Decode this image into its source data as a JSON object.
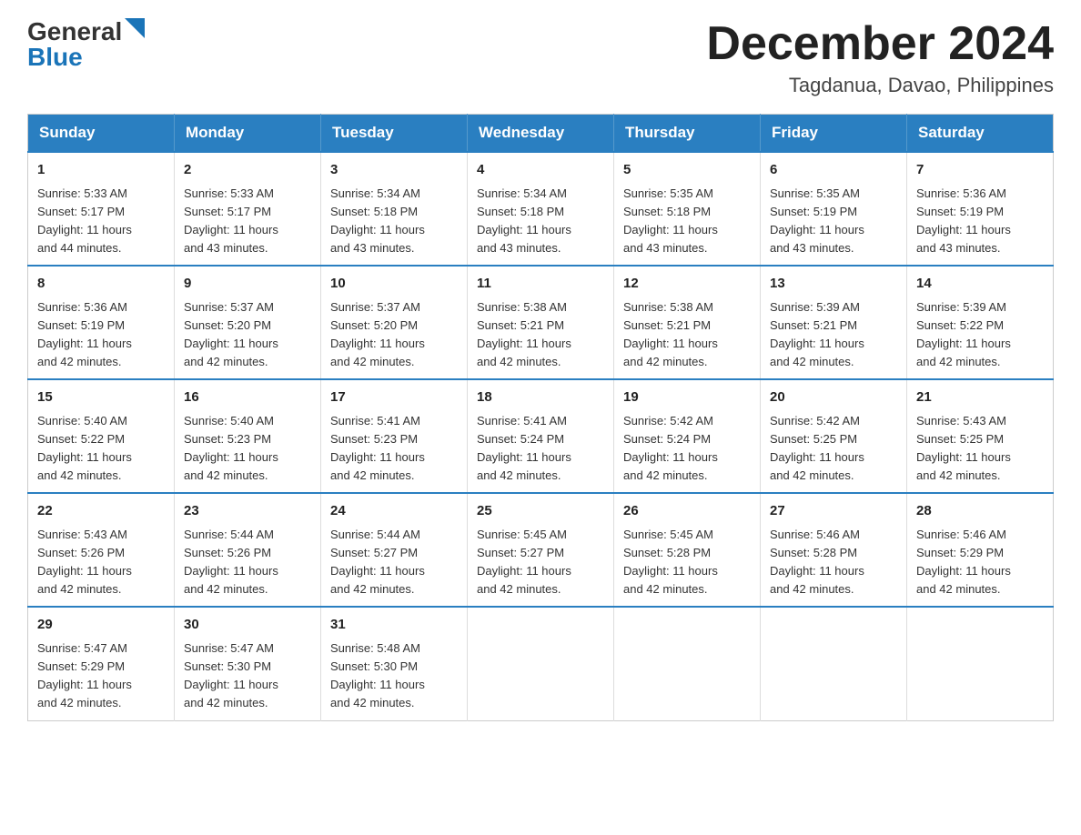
{
  "header": {
    "logo_general": "General",
    "logo_blue": "Blue",
    "month_year": "December 2024",
    "location": "Tagdanua, Davao, Philippines"
  },
  "days_of_week": [
    "Sunday",
    "Monday",
    "Tuesday",
    "Wednesday",
    "Thursday",
    "Friday",
    "Saturday"
  ],
  "weeks": [
    [
      {
        "day": "1",
        "sunrise": "5:33 AM",
        "sunset": "5:17 PM",
        "daylight": "11 hours and 44 minutes."
      },
      {
        "day": "2",
        "sunrise": "5:33 AM",
        "sunset": "5:17 PM",
        "daylight": "11 hours and 43 minutes."
      },
      {
        "day": "3",
        "sunrise": "5:34 AM",
        "sunset": "5:18 PM",
        "daylight": "11 hours and 43 minutes."
      },
      {
        "day": "4",
        "sunrise": "5:34 AM",
        "sunset": "5:18 PM",
        "daylight": "11 hours and 43 minutes."
      },
      {
        "day": "5",
        "sunrise": "5:35 AM",
        "sunset": "5:18 PM",
        "daylight": "11 hours and 43 minutes."
      },
      {
        "day": "6",
        "sunrise": "5:35 AM",
        "sunset": "5:19 PM",
        "daylight": "11 hours and 43 minutes."
      },
      {
        "day": "7",
        "sunrise": "5:36 AM",
        "sunset": "5:19 PM",
        "daylight": "11 hours and 43 minutes."
      }
    ],
    [
      {
        "day": "8",
        "sunrise": "5:36 AM",
        "sunset": "5:19 PM",
        "daylight": "11 hours and 42 minutes."
      },
      {
        "day": "9",
        "sunrise": "5:37 AM",
        "sunset": "5:20 PM",
        "daylight": "11 hours and 42 minutes."
      },
      {
        "day": "10",
        "sunrise": "5:37 AM",
        "sunset": "5:20 PM",
        "daylight": "11 hours and 42 minutes."
      },
      {
        "day": "11",
        "sunrise": "5:38 AM",
        "sunset": "5:21 PM",
        "daylight": "11 hours and 42 minutes."
      },
      {
        "day": "12",
        "sunrise": "5:38 AM",
        "sunset": "5:21 PM",
        "daylight": "11 hours and 42 minutes."
      },
      {
        "day": "13",
        "sunrise": "5:39 AM",
        "sunset": "5:21 PM",
        "daylight": "11 hours and 42 minutes."
      },
      {
        "day": "14",
        "sunrise": "5:39 AM",
        "sunset": "5:22 PM",
        "daylight": "11 hours and 42 minutes."
      }
    ],
    [
      {
        "day": "15",
        "sunrise": "5:40 AM",
        "sunset": "5:22 PM",
        "daylight": "11 hours and 42 minutes."
      },
      {
        "day": "16",
        "sunrise": "5:40 AM",
        "sunset": "5:23 PM",
        "daylight": "11 hours and 42 minutes."
      },
      {
        "day": "17",
        "sunrise": "5:41 AM",
        "sunset": "5:23 PM",
        "daylight": "11 hours and 42 minutes."
      },
      {
        "day": "18",
        "sunrise": "5:41 AM",
        "sunset": "5:24 PM",
        "daylight": "11 hours and 42 minutes."
      },
      {
        "day": "19",
        "sunrise": "5:42 AM",
        "sunset": "5:24 PM",
        "daylight": "11 hours and 42 minutes."
      },
      {
        "day": "20",
        "sunrise": "5:42 AM",
        "sunset": "5:25 PM",
        "daylight": "11 hours and 42 minutes."
      },
      {
        "day": "21",
        "sunrise": "5:43 AM",
        "sunset": "5:25 PM",
        "daylight": "11 hours and 42 minutes."
      }
    ],
    [
      {
        "day": "22",
        "sunrise": "5:43 AM",
        "sunset": "5:26 PM",
        "daylight": "11 hours and 42 minutes."
      },
      {
        "day": "23",
        "sunrise": "5:44 AM",
        "sunset": "5:26 PM",
        "daylight": "11 hours and 42 minutes."
      },
      {
        "day": "24",
        "sunrise": "5:44 AM",
        "sunset": "5:27 PM",
        "daylight": "11 hours and 42 minutes."
      },
      {
        "day": "25",
        "sunrise": "5:45 AM",
        "sunset": "5:27 PM",
        "daylight": "11 hours and 42 minutes."
      },
      {
        "day": "26",
        "sunrise": "5:45 AM",
        "sunset": "5:28 PM",
        "daylight": "11 hours and 42 minutes."
      },
      {
        "day": "27",
        "sunrise": "5:46 AM",
        "sunset": "5:28 PM",
        "daylight": "11 hours and 42 minutes."
      },
      {
        "day": "28",
        "sunrise": "5:46 AM",
        "sunset": "5:29 PM",
        "daylight": "11 hours and 42 minutes."
      }
    ],
    [
      {
        "day": "29",
        "sunrise": "5:47 AM",
        "sunset": "5:29 PM",
        "daylight": "11 hours and 42 minutes."
      },
      {
        "day": "30",
        "sunrise": "5:47 AM",
        "sunset": "5:30 PM",
        "daylight": "11 hours and 42 minutes."
      },
      {
        "day": "31",
        "sunrise": "5:48 AM",
        "sunset": "5:30 PM",
        "daylight": "11 hours and 42 minutes."
      },
      null,
      null,
      null,
      null
    ]
  ],
  "labels": {
    "sunrise": "Sunrise:",
    "sunset": "Sunset:",
    "daylight": "Daylight:"
  }
}
